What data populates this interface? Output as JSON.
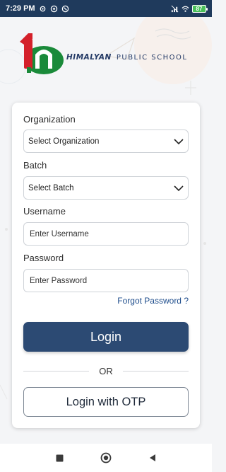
{
  "status_bar": {
    "time": "7:29 PM",
    "battery": "87"
  },
  "brand": {
    "name": "HIMALYAN",
    "sub": "PUBLIC SCHOOL"
  },
  "form": {
    "organization_label": "Organization",
    "organization_value": "Select Organization",
    "batch_label": "Batch",
    "batch_value": "Select Batch",
    "username_label": "Username",
    "username_placeholder": "Enter Username",
    "password_label": "Password",
    "password_placeholder": "Enter Password",
    "forgot_password": "Forgot Password ?",
    "login_button": "Login",
    "or_text": "OR",
    "otp_button": "Login with OTP"
  },
  "icons": {
    "dropdown": "chevron-down-icon",
    "nav_recent": "square-icon",
    "nav_home": "circle-icon",
    "nav_back": "triangle-back-icon"
  },
  "colors": {
    "status_bar": "#1f3a5c",
    "primary": "#2c4a73",
    "link": "#1e4d8c",
    "logo_red": "#d4202a",
    "logo_green": "#1a8a3a"
  }
}
